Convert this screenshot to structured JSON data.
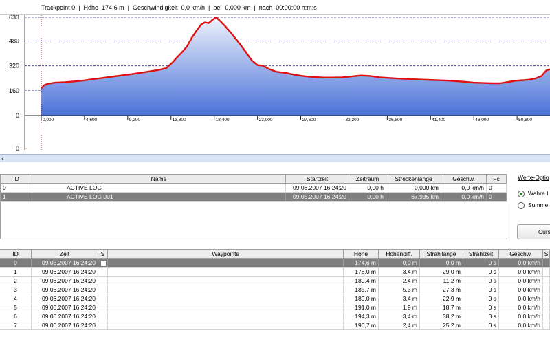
{
  "status": {
    "trackpoint_label": "Trackpoint 0",
    "hoehe": "Höhe  174,6 m",
    "geschwindigkeit": "Geschwindigkeit  0,0 km/h",
    "bei": "bei  0,000 km",
    "nach": "nach  00:00:00 h:m:s"
  },
  "chart_data": {
    "type": "area",
    "ylim": [
      0,
      633
    ],
    "yticks": [
      "633",
      "480",
      "320",
      "160",
      "0"
    ],
    "ytick_values": [
      633,
      480,
      320,
      160,
      0
    ],
    "xticks": [
      "0,000",
      "4,600",
      "9,200",
      "13,800",
      "18,400",
      "23,000",
      "27,600",
      "32,200",
      "36,800",
      "41,400",
      "46,000",
      "50,600"
    ],
    "xtick_values": [
      0,
      4.6,
      9.2,
      13.8,
      18.4,
      23.0,
      27.6,
      32.2,
      36.8,
      41.4,
      46.0,
      50.6
    ],
    "xlim": [
      0,
      54.1
    ],
    "x": [
      0,
      0.3,
      0.7,
      1.5,
      2.5,
      3.5,
      4.5,
      5.5,
      6.5,
      7.5,
      8.5,
      9.5,
      10.5,
      11.5,
      12.5,
      13.3,
      14.0,
      14.5,
      15.0,
      15.5,
      16.0,
      16.5,
      17.0,
      17.4,
      17.8,
      18.2,
      18.6,
      19.0,
      19.5,
      20.0,
      20.6,
      21.2,
      21.8,
      22.4,
      23.0,
      23.6,
      24.2,
      25.0,
      26.0,
      27.0,
      28.0,
      29.0,
      30.0,
      31.0,
      32.0,
      33.0,
      34.0,
      35.0,
      36.0,
      37.0,
      38.0,
      39.0,
      40.0,
      41.0,
      42.0,
      43.0,
      44.0,
      45.0,
      46.0,
      47.0,
      48.0,
      48.8,
      49.5,
      50.5,
      51.3,
      52.0,
      52.6,
      53.2,
      53.7,
      54.1
    ],
    "y": [
      174.6,
      195,
      205,
      212,
      215,
      220,
      226,
      234,
      242,
      250,
      258,
      266,
      275,
      284,
      294,
      305,
      345,
      378,
      410,
      445,
      500,
      545,
      585,
      600,
      595,
      615,
      633,
      610,
      580,
      545,
      500,
      455,
      405,
      355,
      325,
      320,
      300,
      282,
      275,
      262,
      253,
      248,
      245,
      245,
      246,
      252,
      258,
      255,
      246,
      242,
      238,
      236,
      233,
      230,
      228,
      226,
      222,
      218,
      212,
      210,
      208,
      208,
      215,
      225,
      228,
      232,
      240,
      255,
      290,
      298
    ],
    "lower_marker": {
      "line_label": "0"
    }
  },
  "track_table": {
    "columns": [
      "ID",
      "Name",
      "Startzeit",
      "Zeitraum",
      "Streckenlänge",
      "Geschw.",
      "Fc"
    ],
    "rows": [
      {
        "id": "0",
        "name": "ACTIVE LOG",
        "startzeit": "09.06.2007 16:24:20",
        "zeitraum": "0,00 h",
        "strecke": "0,000 km",
        "geschw": "0,0 km/h",
        "fc": "0"
      },
      {
        "id": "1",
        "name": "ACTIVE LOG 001",
        "startzeit": "09.06.2007 16:24:20",
        "zeitraum": "0,00 h",
        "strecke": "67,935 km",
        "geschw": "0,0 km/h",
        "fc": "0"
      }
    ]
  },
  "options": {
    "title": "Werte-Optio",
    "radio1": "Wahre I",
    "radio2": "Summe I",
    "button": "Curs"
  },
  "waypoint_table": {
    "columns": [
      "ID",
      "Zeit",
      "S",
      "Waypoints",
      "Höhe",
      "Höhendiff.",
      "Strahllänge",
      "Strahlzeit",
      "Geschw.",
      "S"
    ],
    "rows": [
      {
        "id": "0",
        "zeit": "09.06.2007 16:24:20",
        "hoehe": "174,6 m",
        "diff": "0,0 m",
        "strahl": "0,0 m",
        "zeit2": "0 s",
        "geschw": "0,0 km/h"
      },
      {
        "id": "1",
        "zeit": "09.06.2007 16:24:20",
        "hoehe": "178,0 m",
        "diff": "3,4 m",
        "strahl": "29,0 m",
        "zeit2": "0 s",
        "geschw": "0,0 km/h"
      },
      {
        "id": "2",
        "zeit": "09.06.2007 16:24:20",
        "hoehe": "180,4 m",
        "diff": "2,4 m",
        "strahl": "11,2 m",
        "zeit2": "0 s",
        "geschw": "0,0 km/h"
      },
      {
        "id": "3",
        "zeit": "09.06.2007 16:24:20",
        "hoehe": "185,7 m",
        "diff": "5,3 m",
        "strahl": "27,3 m",
        "zeit2": "0 s",
        "geschw": "0,0 km/h"
      },
      {
        "id": "4",
        "zeit": "09.06.2007 16:24:20",
        "hoehe": "189,0 m",
        "diff": "3,4 m",
        "strahl": "22,9 m",
        "zeit2": "0 s",
        "geschw": "0,0 km/h"
      },
      {
        "id": "5",
        "zeit": "09.06.2007 16:24:20",
        "hoehe": "191,0 m",
        "diff": "1,9 m",
        "strahl": "18,7 m",
        "zeit2": "0 s",
        "geschw": "0,0 km/h"
      },
      {
        "id": "6",
        "zeit": "09.06.2007 16:24:20",
        "hoehe": "194,3 m",
        "diff": "3,4 m",
        "strahl": "38,2 m",
        "zeit2": "0 s",
        "geschw": "0,0 km/h"
      },
      {
        "id": "7",
        "zeit": "09.06.2007 16:24:20",
        "hoehe": "196,7 m",
        "diff": "2,4 m",
        "strahl": "25,2 m",
        "zeit2": "0 s",
        "geschw": "0,0 km/h"
      }
    ]
  }
}
